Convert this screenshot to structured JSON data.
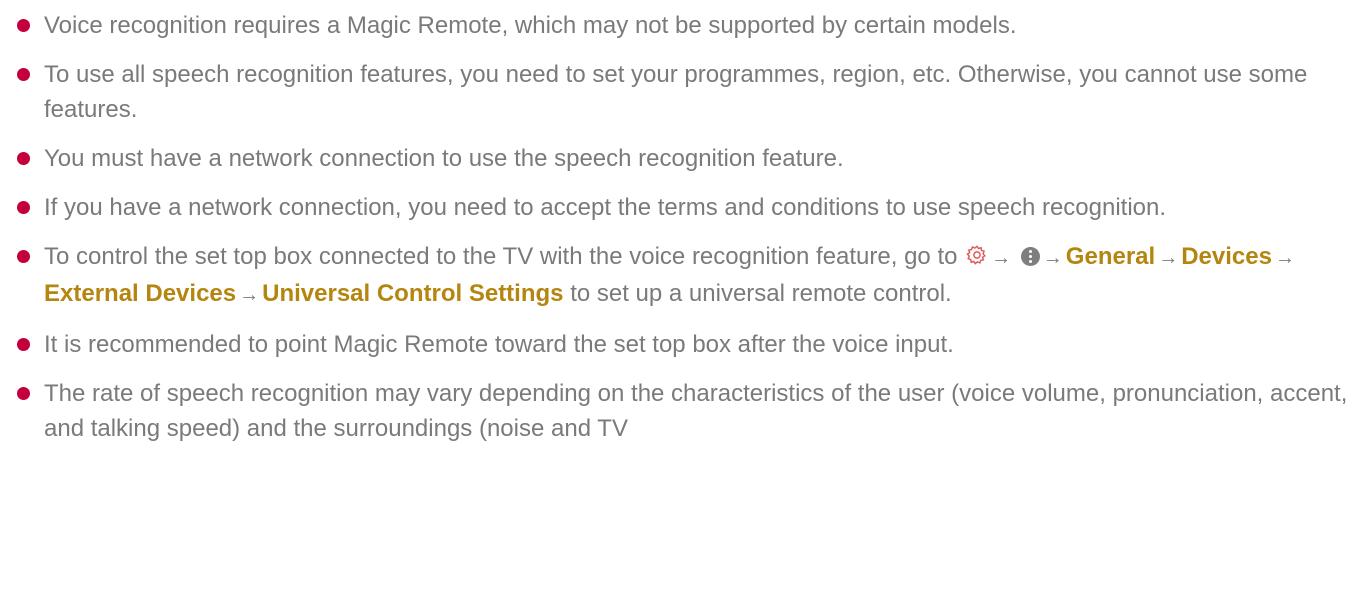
{
  "notes": [
    {
      "text": "Voice recognition requires a Magic Remote, which may not be supported by certain models."
    },
    {
      "text": "To use all speech recognition features, you need to set your programmes, region, etc. Otherwise, you cannot use some features."
    },
    {
      "text": "You must have a network connection to use the speech recognition feature."
    },
    {
      "text": "If you have a network connection, you need to accept the terms and conditions to use speech recognition."
    },
    {
      "prefix": "To control the set top box connected to the TV with the voice recognition feature, go to",
      "path": [
        "General",
        "Devices",
        "External Devices",
        "Universal Control Settings"
      ],
      "arrow": "→",
      "suffix": "to set up a universal remote control."
    },
    {
      "text": "It is recommended to point Magic Remote toward the set top box after the voice input."
    },
    {
      "text": "The rate of speech recognition may vary depending on the characteristics of the user (voice volume, pronunciation, accent, and talking speed) and the surroundings (noise and TV"
    }
  ],
  "colors": {
    "bullet": "#c3003c",
    "link": "#b5860f",
    "text": "#7a7a7a",
    "gear_icon": "#e05a5a"
  },
  "icons": [
    "gear-icon",
    "more-menu-icon",
    "arrow-right-icon"
  ]
}
